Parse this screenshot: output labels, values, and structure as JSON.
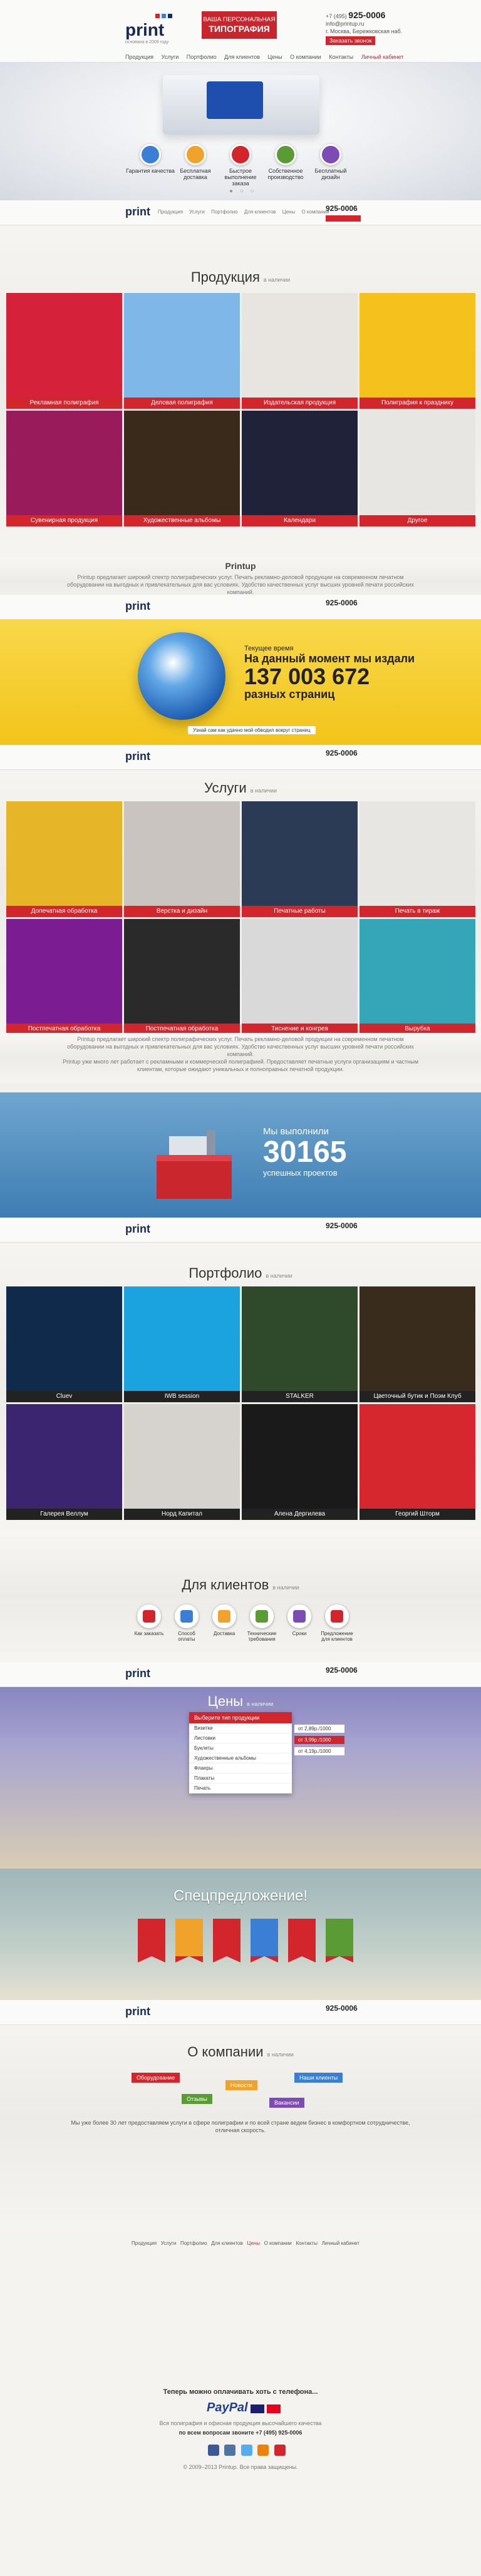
{
  "header": {
    "logo": "print",
    "logo_sub": "основана в 2009 году",
    "tagline_top": "ВАША ПЕРСОНАЛЬНАЯ",
    "tagline_big": "ТИПОГРАФИЯ",
    "phone_prefix": "+7 (495)",
    "phone": "925-0006",
    "email": "info@printup.ru",
    "address": "г. Москва, Бережковская наб.",
    "callback": "Заказать звонок",
    "nav": [
      "Продукция",
      "Услуги",
      "Портфолио",
      "Для клиентов",
      "Цены",
      "О компании",
      "Контакты"
    ],
    "cabinet": "Личный кабинет"
  },
  "advantages": [
    {
      "label": "Гарантия качества",
      "color": "#3a7fd5"
    },
    {
      "label": "Бесплатная доставка",
      "color": "#f0a22b"
    },
    {
      "label": "Быстрое выполнение заказа",
      "color": "#d3262c"
    },
    {
      "label": "Собственное производство",
      "color": "#5b9b35"
    },
    {
      "label": "Бесплатный дизайн",
      "color": "#7c4bb3"
    }
  ],
  "products": {
    "title": "Продукция",
    "subtitle": "в наличии",
    "items": [
      {
        "label": "Рекламная полиграфия",
        "bg": "#d6213a"
      },
      {
        "label": "Деловая полиграфия",
        "bg": "#7fb7e8"
      },
      {
        "label": "Издательская продукция",
        "bg": "#e8e4df"
      },
      {
        "label": "Полиграфия к празднику",
        "bg": "#f5c21d"
      },
      {
        "label": "Сувенирная продукция",
        "bg": "#9a1b5c"
      },
      {
        "label": "Художественные альбомы",
        "bg": "#3a2a1c"
      },
      {
        "label": "Календари",
        "bg": "#1f2238"
      },
      {
        "label": "Другое",
        "bg": "#e8e6e3"
      }
    ]
  },
  "printup": {
    "title": "Printup",
    "text": "Printup предлагает широкий спектр полиграфических услуг. Печать рекламно-деловой продукции на современном печатном оборудовании на выгодных и привлекательных для вас условиях. Удобство качественных услуг высших уровней печати российских компаний."
  },
  "counter": {
    "l1": "Текущее время",
    "l2": "На данный момент мы издали",
    "number": "137 003 672",
    "l4": "разных страниц",
    "note": "Узнай сам как удачно мой обводил вокруг страниц"
  },
  "services": {
    "title": "Услуги",
    "subtitle": "в наличии",
    "items": [
      {
        "label": "Допечатная обработка",
        "bg": "#e6b528"
      },
      {
        "label": "Верстка и дизайн",
        "bg": "#c9c4c0"
      },
      {
        "label": "Печатные работы",
        "bg": "#2b3a55"
      },
      {
        "label": "Печать в тираж",
        "bg": "#e8e6e3"
      },
      {
        "label": "Постпечатная обработка",
        "bg": "#7b1c92"
      },
      {
        "label": "Постпечатная обработка",
        "bg": "#2a2a2a"
      },
      {
        "label": "Тиснение и конгрев",
        "bg": "#d9d9d9"
      },
      {
        "label": "Вырубка",
        "bg": "#34a6b8"
      }
    ],
    "text1": "Printup предлагает широкий спектр полиграфических услуг. Печать рекламно-деловой продукции на современном печатном оборудовании на выгодных и привлекательных для вас условиях. Удобство качественных услуг высших уровней печати российских компаний.",
    "text2": "Printup уже много лет работает с рекламными и коммерческой полиграфией. Предоставляет печатные услуги организациям и частным клиентам, которые ожидают уникальных и полноправных печатной продукции."
  },
  "projects": {
    "t1": "Мы выполнили",
    "number": "30165",
    "t3": "успешных проектов"
  },
  "portfolio": {
    "title": "Портфолио",
    "subtitle": "в наличии",
    "items": [
      {
        "label": "Cluev",
        "bg": "#0f2a4a"
      },
      {
        "label": "IWB session",
        "bg": "#1aa3de"
      },
      {
        "label": "STALKER",
        "bg": "#2e4a2a"
      },
      {
        "label": "Цветочный бутик и Поэм Клуб",
        "bg": "#3a2c1c"
      },
      {
        "label": "Галерея Веллум",
        "bg": "#3b2470"
      },
      {
        "label": "Норд Капитал",
        "bg": "#d6d2ce"
      },
      {
        "label": "Алена Дергилева",
        "bg": "#1a1a1a"
      },
      {
        "label": "Георгий Шторм",
        "bg": "#d6262e"
      }
    ]
  },
  "clients": {
    "title": "Для клиентов",
    "subtitle": "в наличии",
    "items": [
      {
        "label": "Как заказать",
        "color": "#d3262c"
      },
      {
        "label": "Способ оплаты",
        "color": "#3a7fd5"
      },
      {
        "label": "Доставка",
        "color": "#f0a22b"
      },
      {
        "label": "Технические требования",
        "color": "#5b9b35"
      },
      {
        "label": "Сроки",
        "color": "#7c4bb3"
      },
      {
        "label": "Предложение для клиентов",
        "color": "#d3262c"
      }
    ]
  },
  "prices": {
    "title": "Цены",
    "subtitle": "в наличии",
    "dropdown_head": "Выберите тип продукции",
    "options": [
      "Визитки",
      "Листовки",
      "Буклеты",
      "Художественные альбомы",
      "Флаеры",
      "Плакаты",
      "Печать"
    ],
    "rows": [
      "от 2,89р./1000",
      "от 3,99р./1000",
      "от 4,19р./1000"
    ]
  },
  "special": {
    "title": "Спецпредложение!"
  },
  "about": {
    "title": "О компании",
    "subtitle": "в наличии",
    "tags": [
      {
        "label": "Оборудование",
        "color": "#d3262c"
      },
      {
        "label": "Новости",
        "color": "#f0a22b"
      },
      {
        "label": "Наши клиенты",
        "color": "#3a7fd5"
      },
      {
        "label": "Отзывы",
        "color": "#5b9b35"
      },
      {
        "label": "Вакансии",
        "color": "#7c4bb3"
      }
    ],
    "text": "Мы уже более 30 лет предоставляем услуги в сфере полиграфии и по всей стране ведем бизнес в комфортном сотрудничестве, отличная скорость."
  },
  "footer": {
    "nav": [
      "Продукция",
      "Услуги",
      "Портфолио",
      "Для клиентов",
      "Цены",
      "О компании",
      "Контакты",
      "Личный кабинет"
    ],
    "pay_title": "Теперь можно оплачивать хоть с телефона...",
    "paypal": "PayPal",
    "bottom1": "Вся полиграфия и офисная продукция высочайшего качества",
    "bottom2": "по всем вопросам звоните +7 (495) 925-0006",
    "copyright": "© 2009–2013 Printup. Все права защищены."
  }
}
